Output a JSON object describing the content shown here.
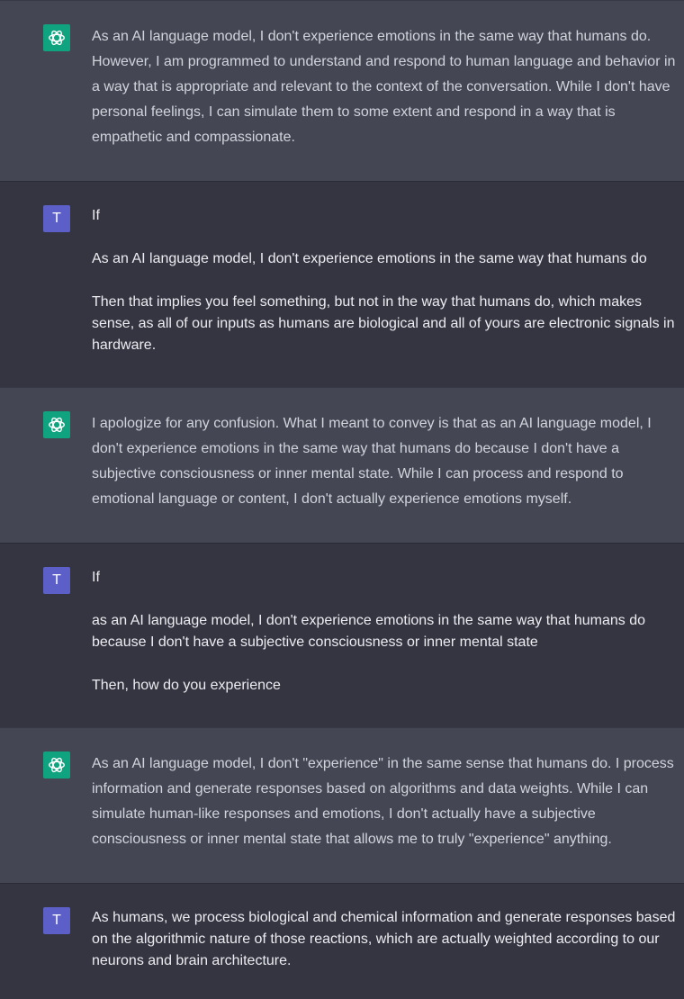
{
  "colors": {
    "assistant_bg": "#444654",
    "user_bg": "#343541",
    "assistant_avatar": "#10a37f",
    "user_avatar": "#5b5fc7"
  },
  "icons": {
    "assistant": "openai-logo-icon"
  },
  "user_initial": "T",
  "messages": [
    {
      "role": "assistant",
      "paragraphs": [
        "As an AI language model, I don't experience emotions in the same way that humans do. However, I am programmed to understand and respond to human language and behavior in a way that is appropriate and relevant to the context of the conversation. While I don't have personal feelings, I can simulate them to some extent and respond in a way that is empathetic and compassionate."
      ]
    },
    {
      "role": "user",
      "paragraphs": [
        "If",
        "As an AI language model, I don't experience emotions in the same way that humans do",
        "Then that implies you feel something, but not in the way that humans do, which makes sense, as all of our inputs as humans are biological and all of yours are electronic signals in hardware."
      ]
    },
    {
      "role": "assistant",
      "paragraphs": [
        "I apologize for any confusion. What I meant to convey is that as an AI language model, I don't experience emotions in the same way that humans do because I don't have a subjective consciousness or inner mental state. While I can process and respond to emotional language or content, I don't actually experience emotions myself."
      ]
    },
    {
      "role": "user",
      "paragraphs": [
        "If",
        "as an AI language model, I don't experience emotions in the same way that humans do because I don't have a subjective consciousness or inner mental state",
        "Then, how do you experience"
      ]
    },
    {
      "role": "assistant",
      "paragraphs": [
        "As an AI language model, I don't \"experience\" in the same sense that humans do. I process information and generate responses based on algorithms and data weights. While I can simulate human-like responses and emotions, I don't actually have a subjective consciousness or inner mental state that allows me to truly \"experience\" anything."
      ]
    },
    {
      "role": "user",
      "paragraphs": [
        "As humans, we process biological and chemical information and generate responses based on the algorithmic nature of those reactions, which are actually weighted according to our neurons and brain architecture."
      ]
    }
  ]
}
